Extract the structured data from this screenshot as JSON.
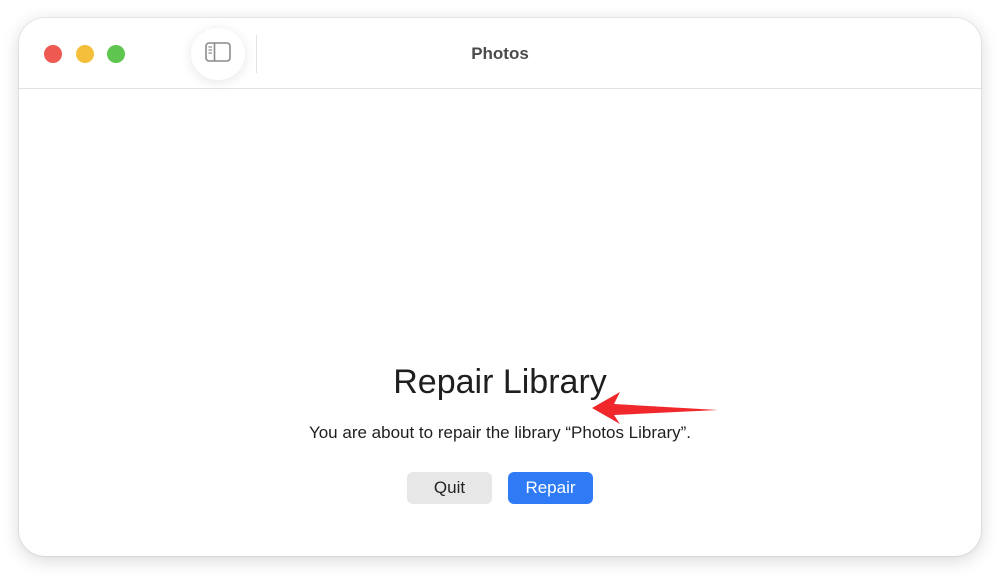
{
  "window": {
    "title": "Photos",
    "controls": {
      "close_color": "#ee5a52",
      "minimize_color": "#f4bf3a",
      "zoom_color": "#5ec64f"
    },
    "toolbar": {
      "sidebar_toggle_icon": "sidebar-icon"
    }
  },
  "dialog": {
    "heading": "Repair Library",
    "message": "You are about to repair the library “Photos Library”.",
    "quit_label": "Quit",
    "repair_label": "Repair",
    "accent_color": "#2f7bf6"
  },
  "annotation": {
    "arrow_color": "#f0282b",
    "arrow_icon": "arrow-left-icon"
  }
}
